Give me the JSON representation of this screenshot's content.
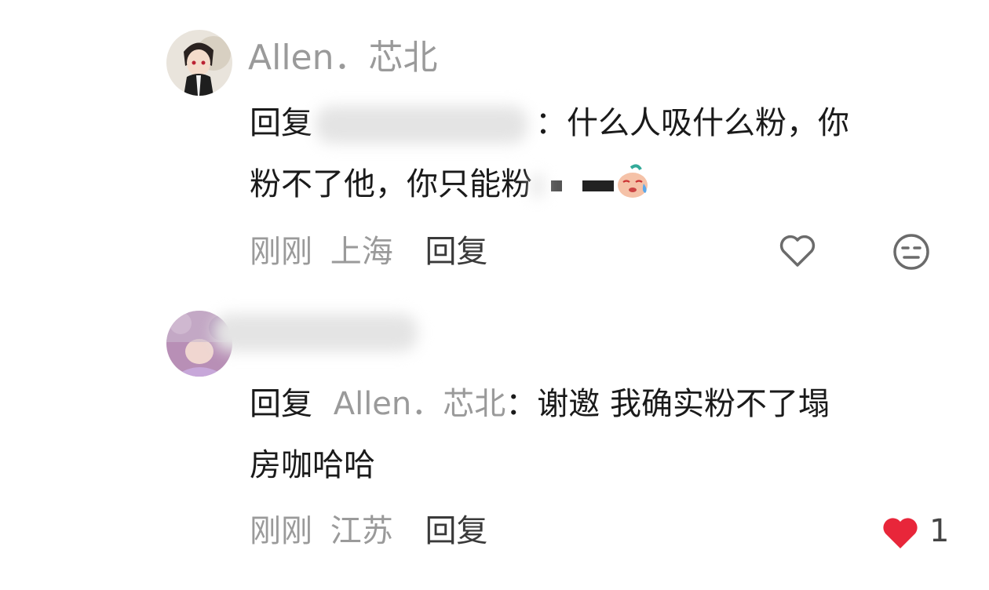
{
  "comments": [
    {
      "username": "Allen．芯北",
      "reply_prefix": "回复",
      "text_line1": "：什么人吸什么粉，你",
      "text_line2": "粉不了他，你只能粉",
      "time": "刚刚",
      "location": "上海",
      "reply_label": "回复",
      "liked": false,
      "like_count": ""
    },
    {
      "username": "",
      "reply_prefix": "回复",
      "mention": "Allen．芯北",
      "text_line1": "：谢邀 我确实粉不了塌",
      "text_line2": "房咖哈哈",
      "time": "刚刚",
      "location": "江苏",
      "reply_label": "回复",
      "liked": true,
      "like_count": "1"
    }
  ],
  "colors": {
    "like_active": "#e8263a",
    "muted_text": "#9a9a9a",
    "icon_gray": "#6b6b6b"
  },
  "icons": [
    "heart-outline-icon",
    "meh-face-icon",
    "heart-filled-icon",
    "crying-emoji-icon"
  ]
}
